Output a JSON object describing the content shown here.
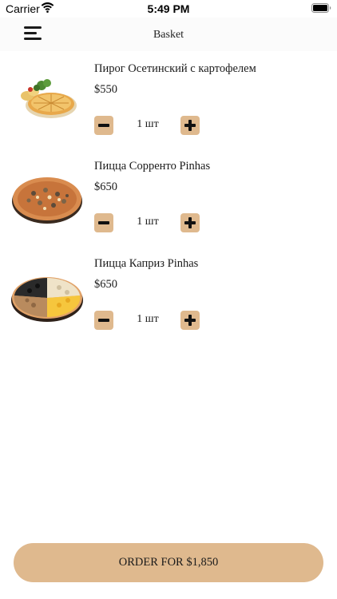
{
  "status_bar": {
    "carrier": "Carrier",
    "time": "5:49 PM"
  },
  "nav": {
    "title": "Basket",
    "menu_icon": "hamburger-menu-icon"
  },
  "items": [
    {
      "name": "Пирог Осетинский с картофелем",
      "price": "$550",
      "quantity": "1 шт",
      "image": "pie-image"
    },
    {
      "name": "Пицца Сорренто Pinhas",
      "price": "$650",
      "quantity": "1 шт",
      "image": "pizza-image"
    },
    {
      "name": "Пицца Каприз Pinhas",
      "price": "$650",
      "quantity": "1 шт",
      "image": "pizza-image"
    }
  ],
  "order": {
    "label": "ORDER FOR $1,850"
  },
  "colors": {
    "accent": "#dfb98e",
    "text": "#1a1a1a",
    "nav_background": "#fbfbfb"
  }
}
